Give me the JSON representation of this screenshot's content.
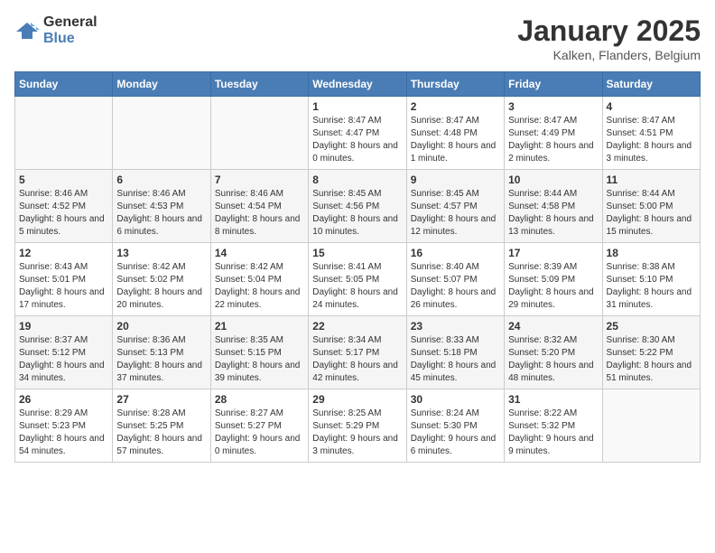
{
  "header": {
    "logo_general": "General",
    "logo_blue": "Blue",
    "title": "January 2025",
    "subtitle": "Kalken, Flanders, Belgium"
  },
  "weekdays": [
    "Sunday",
    "Monday",
    "Tuesday",
    "Wednesday",
    "Thursday",
    "Friday",
    "Saturday"
  ],
  "weeks": [
    [
      {
        "day": "",
        "info": ""
      },
      {
        "day": "",
        "info": ""
      },
      {
        "day": "",
        "info": ""
      },
      {
        "day": "1",
        "info": "Sunrise: 8:47 AM\nSunset: 4:47 PM\nDaylight: 8 hours and 0 minutes."
      },
      {
        "day": "2",
        "info": "Sunrise: 8:47 AM\nSunset: 4:48 PM\nDaylight: 8 hours and 1 minute."
      },
      {
        "day": "3",
        "info": "Sunrise: 8:47 AM\nSunset: 4:49 PM\nDaylight: 8 hours and 2 minutes."
      },
      {
        "day": "4",
        "info": "Sunrise: 8:47 AM\nSunset: 4:51 PM\nDaylight: 8 hours and 3 minutes."
      }
    ],
    [
      {
        "day": "5",
        "info": "Sunrise: 8:46 AM\nSunset: 4:52 PM\nDaylight: 8 hours and 5 minutes."
      },
      {
        "day": "6",
        "info": "Sunrise: 8:46 AM\nSunset: 4:53 PM\nDaylight: 8 hours and 6 minutes."
      },
      {
        "day": "7",
        "info": "Sunrise: 8:46 AM\nSunset: 4:54 PM\nDaylight: 8 hours and 8 minutes."
      },
      {
        "day": "8",
        "info": "Sunrise: 8:45 AM\nSunset: 4:56 PM\nDaylight: 8 hours and 10 minutes."
      },
      {
        "day": "9",
        "info": "Sunrise: 8:45 AM\nSunset: 4:57 PM\nDaylight: 8 hours and 12 minutes."
      },
      {
        "day": "10",
        "info": "Sunrise: 8:44 AM\nSunset: 4:58 PM\nDaylight: 8 hours and 13 minutes."
      },
      {
        "day": "11",
        "info": "Sunrise: 8:44 AM\nSunset: 5:00 PM\nDaylight: 8 hours and 15 minutes."
      }
    ],
    [
      {
        "day": "12",
        "info": "Sunrise: 8:43 AM\nSunset: 5:01 PM\nDaylight: 8 hours and 17 minutes."
      },
      {
        "day": "13",
        "info": "Sunrise: 8:42 AM\nSunset: 5:02 PM\nDaylight: 8 hours and 20 minutes."
      },
      {
        "day": "14",
        "info": "Sunrise: 8:42 AM\nSunset: 5:04 PM\nDaylight: 8 hours and 22 minutes."
      },
      {
        "day": "15",
        "info": "Sunrise: 8:41 AM\nSunset: 5:05 PM\nDaylight: 8 hours and 24 minutes."
      },
      {
        "day": "16",
        "info": "Sunrise: 8:40 AM\nSunset: 5:07 PM\nDaylight: 8 hours and 26 minutes."
      },
      {
        "day": "17",
        "info": "Sunrise: 8:39 AM\nSunset: 5:09 PM\nDaylight: 8 hours and 29 minutes."
      },
      {
        "day": "18",
        "info": "Sunrise: 8:38 AM\nSunset: 5:10 PM\nDaylight: 8 hours and 31 minutes."
      }
    ],
    [
      {
        "day": "19",
        "info": "Sunrise: 8:37 AM\nSunset: 5:12 PM\nDaylight: 8 hours and 34 minutes."
      },
      {
        "day": "20",
        "info": "Sunrise: 8:36 AM\nSunset: 5:13 PM\nDaylight: 8 hours and 37 minutes."
      },
      {
        "day": "21",
        "info": "Sunrise: 8:35 AM\nSunset: 5:15 PM\nDaylight: 8 hours and 39 minutes."
      },
      {
        "day": "22",
        "info": "Sunrise: 8:34 AM\nSunset: 5:17 PM\nDaylight: 8 hours and 42 minutes."
      },
      {
        "day": "23",
        "info": "Sunrise: 8:33 AM\nSunset: 5:18 PM\nDaylight: 8 hours and 45 minutes."
      },
      {
        "day": "24",
        "info": "Sunrise: 8:32 AM\nSunset: 5:20 PM\nDaylight: 8 hours and 48 minutes."
      },
      {
        "day": "25",
        "info": "Sunrise: 8:30 AM\nSunset: 5:22 PM\nDaylight: 8 hours and 51 minutes."
      }
    ],
    [
      {
        "day": "26",
        "info": "Sunrise: 8:29 AM\nSunset: 5:23 PM\nDaylight: 8 hours and 54 minutes."
      },
      {
        "day": "27",
        "info": "Sunrise: 8:28 AM\nSunset: 5:25 PM\nDaylight: 8 hours and 57 minutes."
      },
      {
        "day": "28",
        "info": "Sunrise: 8:27 AM\nSunset: 5:27 PM\nDaylight: 9 hours and 0 minutes."
      },
      {
        "day": "29",
        "info": "Sunrise: 8:25 AM\nSunset: 5:29 PM\nDaylight: 9 hours and 3 minutes."
      },
      {
        "day": "30",
        "info": "Sunrise: 8:24 AM\nSunset: 5:30 PM\nDaylight: 9 hours and 6 minutes."
      },
      {
        "day": "31",
        "info": "Sunrise: 8:22 AM\nSunset: 5:32 PM\nDaylight: 9 hours and 9 minutes."
      },
      {
        "day": "",
        "info": ""
      }
    ]
  ]
}
